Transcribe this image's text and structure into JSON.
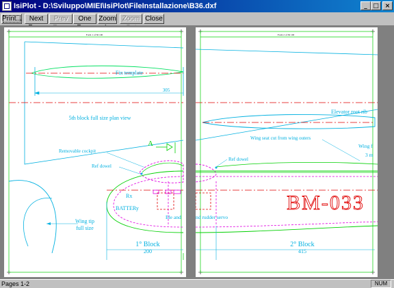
{
  "window": {
    "title": "IsiPlot - D:\\Sviluppo\\MIEI\\IsiPlot\\FileInstallazione\\B36.dxf"
  },
  "toolbar": {
    "buttons": [
      {
        "label": "Print...",
        "enabled": true
      },
      {
        "label": "Next Page",
        "enabled": true
      },
      {
        "label": "Prev Page",
        "enabled": false
      },
      {
        "label": "One Page",
        "enabled": true
      },
      {
        "label": "Zoom In",
        "enabled": true
      },
      {
        "label": "Zoom Out",
        "enabled": false
      },
      {
        "label": "Close",
        "enabled": true
      }
    ]
  },
  "page1": {
    "header": "Form 1 of 36 100",
    "fin_template": "Fin template",
    "dim_305": "305",
    "plan_view": "5th block full size plan view",
    "removable_cockpit": "Removable cockpit",
    "ref_dowel": "Ref dowel",
    "arrow_a": "A",
    "rx": "Rx",
    "battery": "BATTERy",
    "ele_and": "Ele and",
    "wing_tip": "Wing tip",
    "full_size": "full size",
    "block": "1° Block",
    "dim_200": "200"
  },
  "page2": {
    "header": "Form 2 of 36 100",
    "elevator_root_rib": "Elevator root rib",
    "wing_seat": "Wing seat cut from wing outers",
    "ref_dowel": "Ref dowel",
    "wing_f": "Wing f",
    "three_m": "3 m",
    "bm033": "BM-033",
    "rudder_servo": "nd rudder servo",
    "block": "2° Block",
    "dim_415": "415"
  },
  "status": {
    "pages": "Pages 1-2",
    "num": "NUM"
  },
  "colors": {
    "title_gradient_start": "#000080",
    "title_gradient_end": "#1084d0",
    "cyan": "#00b0e0",
    "green": "#00d000",
    "red": "#e00000",
    "magenta": "#e000e0",
    "lightcyan": "#60e0ff"
  }
}
